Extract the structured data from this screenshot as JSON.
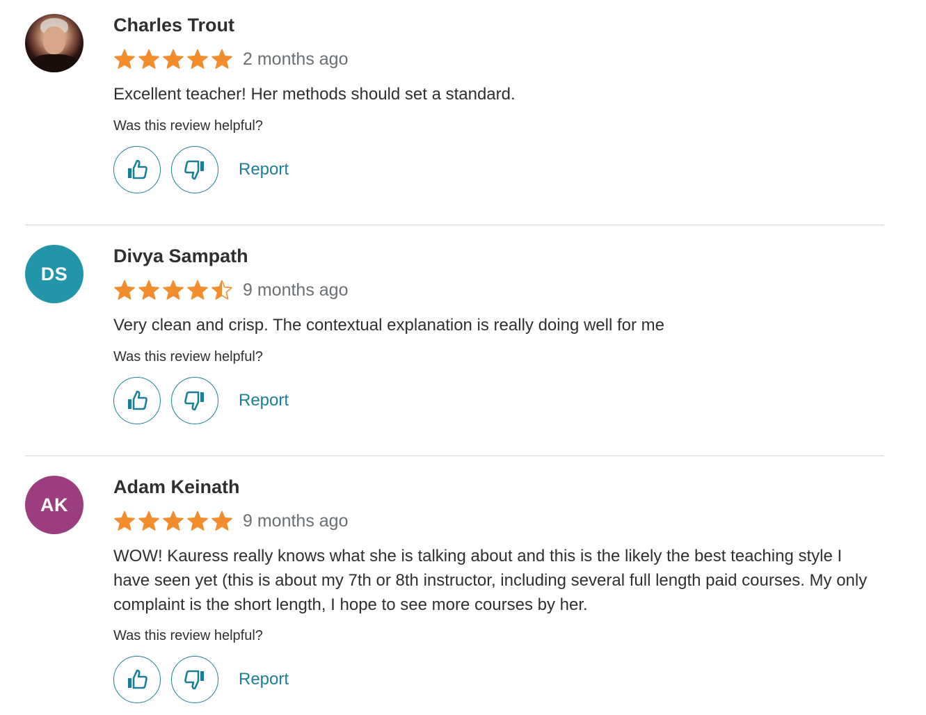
{
  "colors": {
    "star": "#f28d2e",
    "link": "#1a7f96",
    "divider": "#d1d7dc",
    "avatar_ds": "#2296a8",
    "avatar_ak": "#9b3d7e"
  },
  "icons": {
    "thumbs_up": "thumbs-up-icon",
    "thumbs_down": "thumbs-down-icon",
    "star": "star-icon"
  },
  "reviews": [
    {
      "name": "Charles Trout",
      "avatar": {
        "type": "photo",
        "initials": ""
      },
      "rating": 5,
      "time": "2 months ago",
      "text": "Excellent teacher! Her methods should set a standard.",
      "helpful_prompt": "Was this review helpful?",
      "report_label": "Report"
    },
    {
      "name": "Divya Sampath",
      "avatar": {
        "type": "initials",
        "initials": "DS"
      },
      "rating": 4.5,
      "time": "9 months ago",
      "text": "Very clean and crisp. The contextual explanation is really doing well for me",
      "helpful_prompt": "Was this review helpful?",
      "report_label": "Report"
    },
    {
      "name": "Adam Keinath",
      "avatar": {
        "type": "initials",
        "initials": "AK"
      },
      "rating": 5,
      "time": "9 months ago",
      "text": "WOW! Kauress really knows what she is talking about and this is the likely the best teaching style I have seen yet (this is about my 7th or 8th instructor, including several full length paid courses. My only complaint is the short length, I hope to see more courses by her.",
      "helpful_prompt": "Was this review helpful?",
      "report_label": "Report"
    }
  ]
}
